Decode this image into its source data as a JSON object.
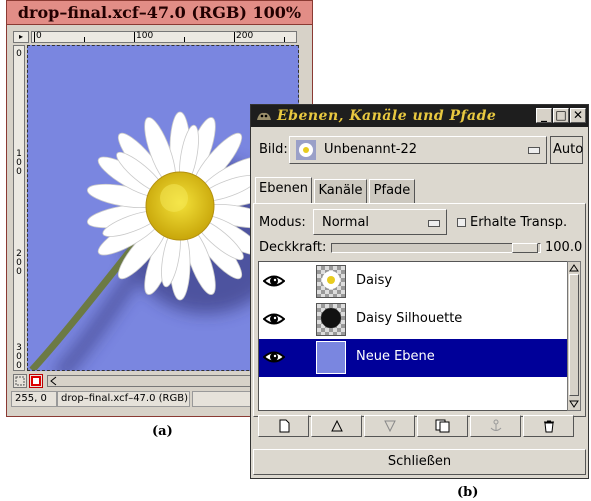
{
  "image_window": {
    "title": "drop–final.xcf–47.0 (RGB) 100%",
    "ruler_h_labels": [
      "0",
      "100",
      "200"
    ],
    "ruler_v_labels": [
      "0",
      "100",
      "200",
      "300"
    ],
    "status_coords": "255, 0",
    "status_file": "drop–final.xcf–47.0 (RGB)",
    "colors": {
      "titlebar": "#e28d86",
      "canvas_bg": "#7a86e0"
    }
  },
  "captions": {
    "a": "(a)",
    "b": "(b)"
  },
  "layers_dialog": {
    "title": "Ebenen, Kanäle und Pfade",
    "window_buttons": [
      "minimize",
      "maximize",
      "close"
    ],
    "image_label": "Bild:",
    "image_value": "Unbenannt-22",
    "auto_label": "Auto",
    "tabs": [
      {
        "label": "Ebenen",
        "active": true
      },
      {
        "label": "Kanäle",
        "active": false
      },
      {
        "label": "Pfade",
        "active": false
      }
    ],
    "mode_label": "Modus:",
    "mode_value": "Normal",
    "preserve_transparency_label": "Erhalte Transp.",
    "opacity_label": "Deckkraft:",
    "opacity_value": "100.0",
    "layers": [
      {
        "name": "Daisy",
        "visible": true,
        "selected": false
      },
      {
        "name": "Daisy Silhouette",
        "visible": true,
        "selected": false
      },
      {
        "name": "Neue Ebene",
        "visible": true,
        "selected": true
      }
    ],
    "action_icons": [
      "new-layer-icon",
      "raise-layer-icon",
      "lower-layer-icon",
      "duplicate-layer-icon",
      "anchor-icon",
      "delete-icon"
    ],
    "close_label": "Schließen",
    "colors": {
      "selection": "#000099",
      "title_text": "#e8c840",
      "layer_fill": "#7a86e0"
    }
  }
}
